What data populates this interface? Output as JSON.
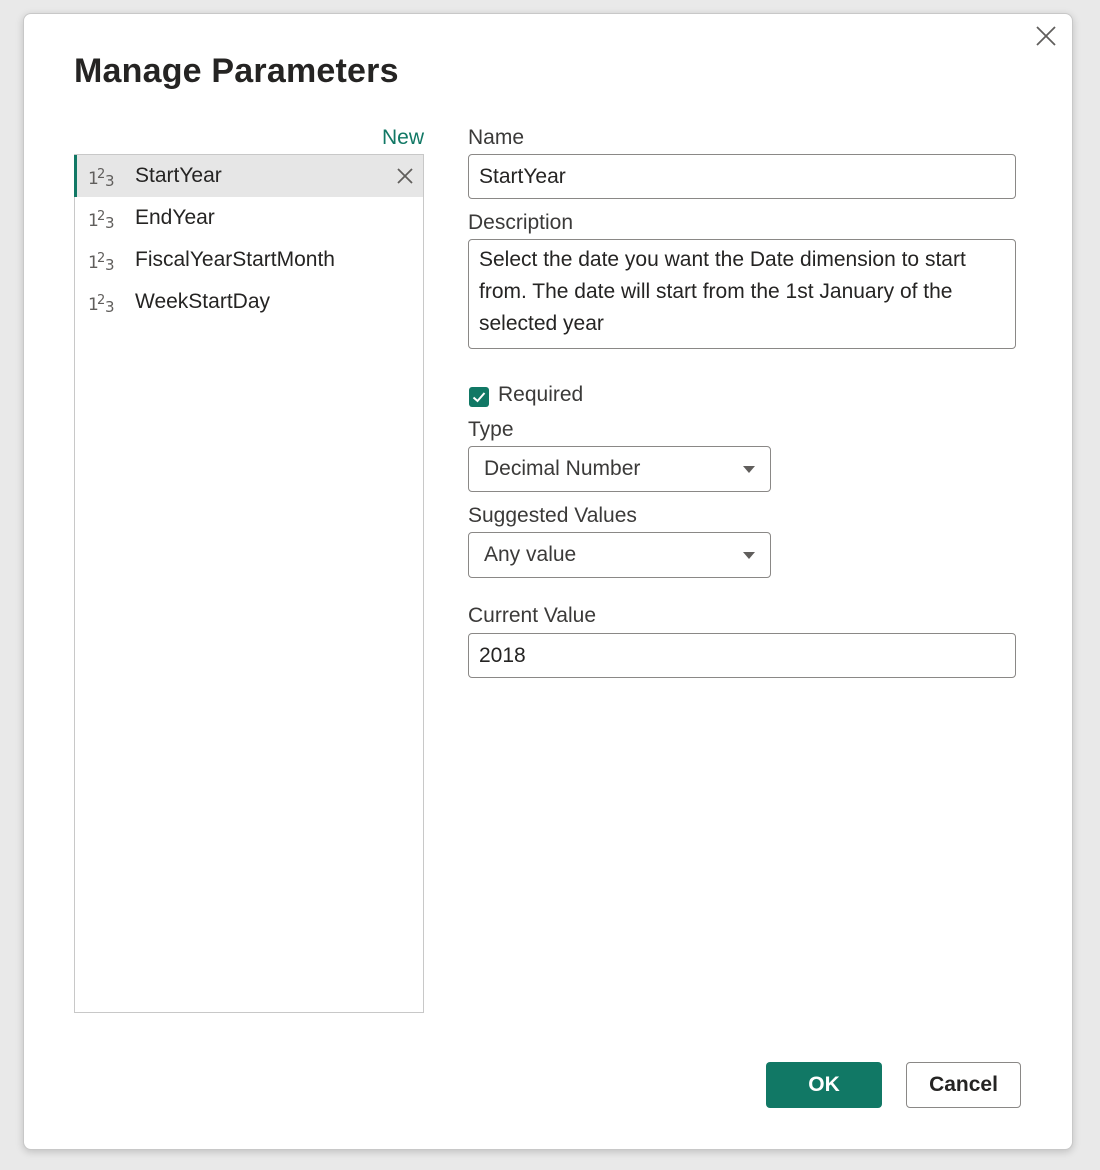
{
  "dialog": {
    "title": "Manage Parameters",
    "new_label": "New"
  },
  "parameters": [
    {
      "name": "StartYear",
      "type_icon": "number-type-icon",
      "selected": true
    },
    {
      "name": "EndYear",
      "type_icon": "number-type-icon",
      "selected": false
    },
    {
      "name": "FiscalYearStartMonth",
      "type_icon": "number-type-icon",
      "selected": false
    },
    {
      "name": "WeekStartDay",
      "type_icon": "number-type-icon",
      "selected": false
    }
  ],
  "form": {
    "name_label": "Name",
    "name_value": "StartYear",
    "description_label": "Description",
    "description_value": "Select the date you want the Date dimension to start from. The date will start from the 1st January of the selected year",
    "required_label": "Required",
    "required_checked": true,
    "type_label": "Type",
    "type_value": "Decimal Number",
    "suggested_label": "Suggested Values",
    "suggested_value": "Any value",
    "current_label": "Current Value",
    "current_value": "2018"
  },
  "buttons": {
    "ok": "OK",
    "cancel": "Cancel"
  },
  "colors": {
    "accent": "#117865",
    "selected_row": "#e6e6e6",
    "border": "#8a8886"
  }
}
